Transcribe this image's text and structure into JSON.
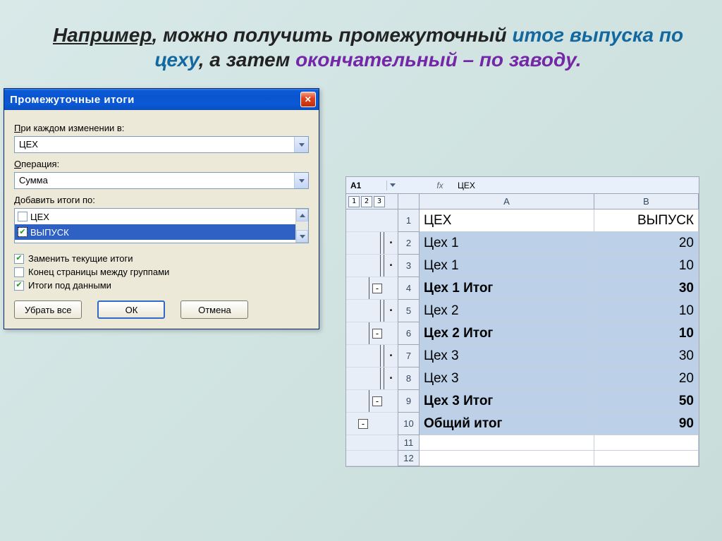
{
  "headline": {
    "lead": "Например",
    "p1": ", можно получить промежуточный ",
    "blue1": "итог выпуска по цеху",
    "p2": ", а затем ",
    "purp": "окончательный – по заводу."
  },
  "dialog": {
    "title": "Промежуточные итоги",
    "label_change": "При каждом изменении в:",
    "combo_change": "ЦЕХ",
    "label_op": "Операция:",
    "combo_op": "Сумма",
    "label_add": "Добавить итоги по:",
    "list": [
      {
        "label": "ЦЕХ",
        "checked": false,
        "selected": false
      },
      {
        "label": "ВЫПУСК",
        "checked": true,
        "selected": true
      }
    ],
    "chk_replace": "Заменить текущие итоги",
    "chk_pagebreak": "Конец страницы между группами",
    "chk_below": "Итоги под данными",
    "btn_remove": "Убрать все",
    "btn_ok": "ОК",
    "btn_cancel": "Отмена"
  },
  "sheet": {
    "namebox": "A1",
    "fxval": "ЦЕХ",
    "col_labels": {
      "A": "A",
      "B": "B"
    },
    "outline_head": [
      "1",
      "2",
      "3"
    ],
    "rows": [
      {
        "n": 1,
        "a": "ЦЕХ",
        "b": "ВЫПУСК",
        "hdr": true,
        "outline": ""
      },
      {
        "n": 2,
        "a": "Цех 1",
        "b": "20",
        "outline": "dot"
      },
      {
        "n": 3,
        "a": "Цех 1",
        "b": "10",
        "outline": "dot"
      },
      {
        "n": 4,
        "a": "Цех 1 Итог",
        "b": "30",
        "bold": true,
        "outline": "minus"
      },
      {
        "n": 5,
        "a": "Цех 2",
        "b": "10",
        "outline": "dot"
      },
      {
        "n": 6,
        "a": "Цех 2 Итог",
        "b": "10",
        "bold": true,
        "outline": "minus"
      },
      {
        "n": 7,
        "a": "Цех 3",
        "b": "30",
        "outline": "dot"
      },
      {
        "n": 8,
        "a": "Цех 3",
        "b": "20",
        "outline": "dot"
      },
      {
        "n": 9,
        "a": "Цех 3 Итог",
        "b": "50",
        "bold": true,
        "outline": "minus"
      },
      {
        "n": 10,
        "a": "Общий итог",
        "b": "90",
        "bold": true,
        "outline": "minus1"
      },
      {
        "n": 11,
        "a": "",
        "b": "",
        "empty": true
      },
      {
        "n": 12,
        "a": "",
        "b": "",
        "empty": true
      }
    ]
  }
}
